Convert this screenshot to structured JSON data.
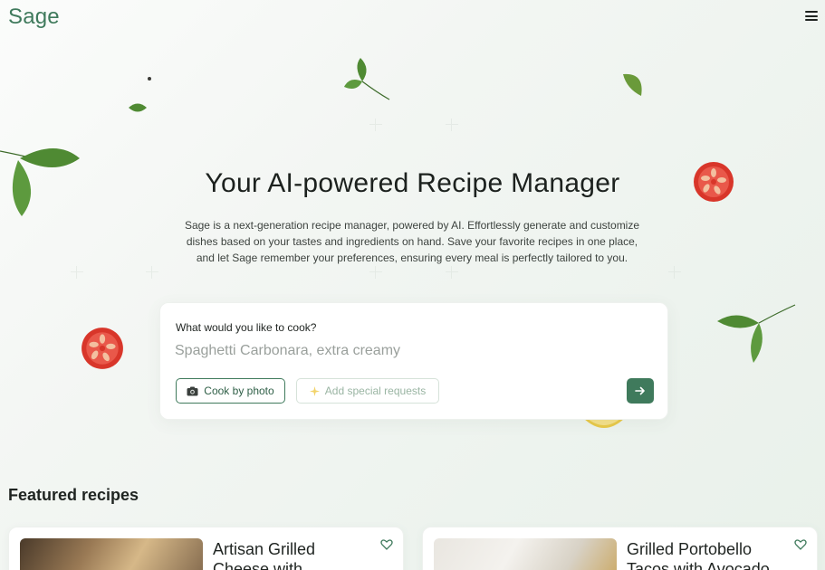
{
  "header": {
    "brand": "Sage",
    "menu_icon": "hamburger-icon"
  },
  "hero": {
    "title": "Your AI-powered Recipe Manager",
    "description": "Sage is a next-generation recipe manager, powered by AI. Effortlessly generate and customize dishes based on your tastes and ingredients on hand. Save your favorite recipes in one place, and let Sage remember your preferences, ensuring every meal is perfectly tailored to you."
  },
  "cook": {
    "label": "What would you like to cook?",
    "input_value": "",
    "placeholder": "Spaghetti Carbonara, extra creamy",
    "photo_button": "Cook by photo",
    "photo_icon": "camera-icon",
    "special_button": "Add special requests",
    "special_icon": "sparkle-icon",
    "submit_icon": "arrow-right-icon"
  },
  "featured": {
    "title": "Featured recipes",
    "recipes": [
      {
        "title": "Artisan Grilled Cheese with",
        "favorite_icon": "heart-icon"
      },
      {
        "title": "Grilled Portobello Tacos with Avocado",
        "favorite_icon": "heart-icon"
      }
    ]
  },
  "colors": {
    "accent": "#3f7a5c",
    "tomato": "#d8362a",
    "leaf": "#5a8a3a"
  }
}
